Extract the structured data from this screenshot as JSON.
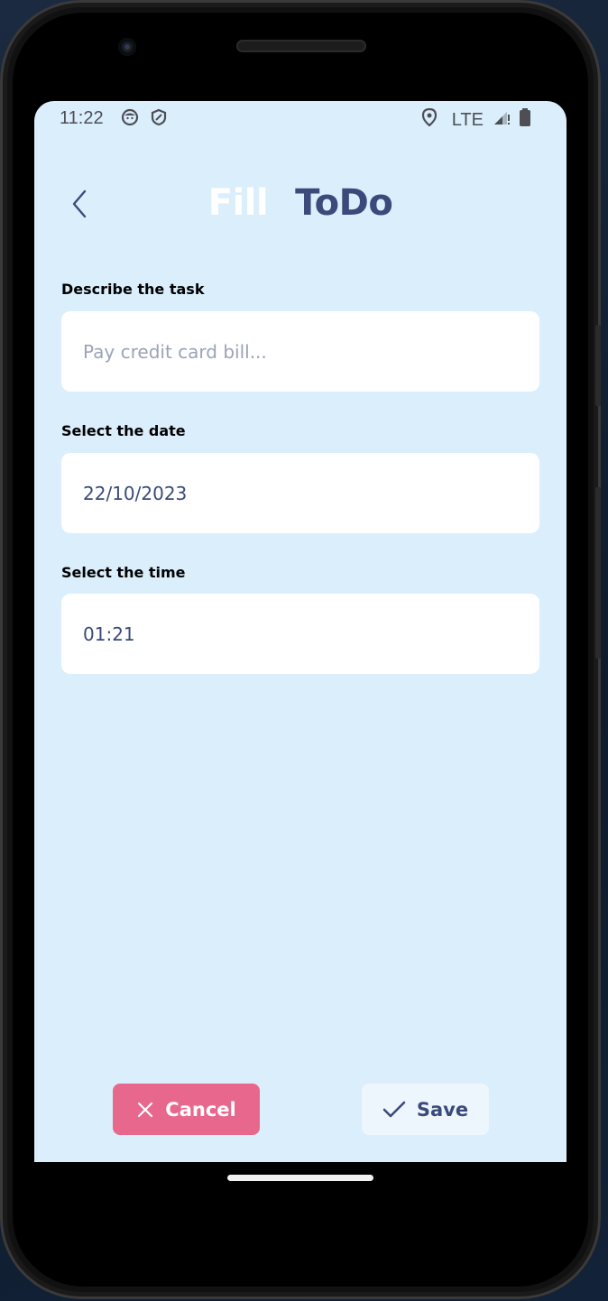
{
  "status_bar": {
    "time": "11:22",
    "network": "LTE",
    "icons": [
      "face-icon",
      "shield-icon",
      "location-icon",
      "signal-icon",
      "battery-icon"
    ]
  },
  "header": {
    "title_part1": "Fill",
    "title_part2": "ToDo",
    "back_icon": "chevron-left-icon"
  },
  "form": {
    "task": {
      "label": "Describe the task",
      "value": "",
      "placeholder": "Pay credit card bill..."
    },
    "date": {
      "label": "Select the date",
      "value": "22/10/2023"
    },
    "time": {
      "label": "Select the time",
      "value": "01:21"
    }
  },
  "actions": {
    "cancel_label": "Cancel",
    "save_label": "Save"
  },
  "colors": {
    "screen_bg": "#dbeefc",
    "title_accent": "#3a4a7a",
    "cancel_bg": "#e8678c",
    "save_bg": "#eef6fd"
  }
}
